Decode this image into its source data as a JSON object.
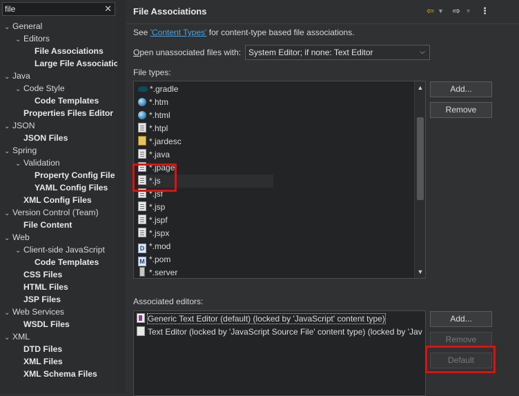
{
  "filter": {
    "value": "file"
  },
  "tree": [
    {
      "label": "General",
      "level": 0,
      "expanded": true,
      "bold": false
    },
    {
      "label": "Editors",
      "level": 1,
      "expanded": true,
      "bold": false
    },
    {
      "label": "File Associations",
      "level": 2,
      "bold": true
    },
    {
      "label": "Large File Associatio",
      "level": 2,
      "bold": true
    },
    {
      "label": "Java",
      "level": 0,
      "expanded": true,
      "bold": false
    },
    {
      "label": "Code Style",
      "level": 1,
      "expanded": true,
      "bold": false
    },
    {
      "label": "Code Templates",
      "level": 2,
      "bold": true
    },
    {
      "label": "Properties Files Editor",
      "level": 1,
      "bold": true
    },
    {
      "label": "JSON",
      "level": 0,
      "expanded": true,
      "bold": false
    },
    {
      "label": "JSON Files",
      "level": 1,
      "bold": true
    },
    {
      "label": "Spring",
      "level": 0,
      "expanded": true,
      "bold": false
    },
    {
      "label": "Validation",
      "level": 1,
      "expanded": true,
      "bold": false
    },
    {
      "label": "Property Config File",
      "level": 2,
      "bold": true
    },
    {
      "label": "YAML Config Files",
      "level": 2,
      "bold": true
    },
    {
      "label": "XML Config Files",
      "level": 1,
      "bold": true
    },
    {
      "label": "Version Control (Team)",
      "level": 0,
      "expanded": true,
      "bold": false
    },
    {
      "label": "File Content",
      "level": 1,
      "bold": true
    },
    {
      "label": "Web",
      "level": 0,
      "expanded": true,
      "bold": false
    },
    {
      "label": "Client-side JavaScript",
      "level": 1,
      "expanded": true,
      "bold": false
    },
    {
      "label": "Code Templates",
      "level": 2,
      "bold": true
    },
    {
      "label": "CSS Files",
      "level": 1,
      "bold": true
    },
    {
      "label": "HTML Files",
      "level": 1,
      "bold": true
    },
    {
      "label": "JSP Files",
      "level": 1,
      "bold": true
    },
    {
      "label": "Web Services",
      "level": 0,
      "expanded": true,
      "bold": false
    },
    {
      "label": "WSDL Files",
      "level": 1,
      "bold": true
    },
    {
      "label": "XML",
      "level": 0,
      "expanded": true,
      "bold": false
    },
    {
      "label": "DTD Files",
      "level": 1,
      "bold": true
    },
    {
      "label": "XML Files",
      "level": 1,
      "bold": true
    },
    {
      "label": "XML Schema Files",
      "level": 1,
      "bold": true
    }
  ],
  "page": {
    "title": "File Associations",
    "see_prefix": "See ",
    "see_link": "'Content Types'",
    "see_suffix": " for content-type based file associations.",
    "open_unassoc_label": "Open unassociated files with:",
    "open_unassoc_value": "System Editor; if none: Text Editor",
    "file_types_label": "File types:",
    "associated_editors_label": "Associated editors:"
  },
  "file_types": [
    {
      "name": "*.gradle",
      "icon": "gradle-icon"
    },
    {
      "name": "*.htm",
      "icon": "globe-icon"
    },
    {
      "name": "*.html",
      "icon": "globe-icon"
    },
    {
      "name": "*.htpl",
      "icon": "file-icon"
    },
    {
      "name": "*.jardesc",
      "icon": "jar-icon"
    },
    {
      "name": "*.java",
      "icon": "file-icon"
    },
    {
      "name": "*.jpage",
      "icon": "file-icon"
    },
    {
      "name": "*.js",
      "icon": "file-icon"
    },
    {
      "name": "*.jsf",
      "icon": "file-icon"
    },
    {
      "name": "*.jsp",
      "icon": "file-icon"
    },
    {
      "name": "*.jspf",
      "icon": "file-icon"
    },
    {
      "name": "*.jspx",
      "icon": "file-icon"
    },
    {
      "name": "*.mod",
      "icon": "d-badge-icon",
      "badge": "D"
    },
    {
      "name": "*.pom",
      "icon": "m-badge-icon",
      "badge": "M"
    },
    {
      "name": "*.server",
      "icon": "server-icon"
    }
  ],
  "editors": [
    {
      "name": "Generic Text Editor (default) (locked by 'JavaScript' content type)",
      "icon": "generic-editor-icon"
    },
    {
      "name": "Text Editor (locked by 'JavaScript Source File' content type) (locked by 'Jav",
      "icon": "text-editor-icon"
    }
  ],
  "buttons": {
    "add_file": "Add...",
    "remove_file": "Remove",
    "add_editor": "Add...",
    "remove_editor": "Remove",
    "default_editor": "Default"
  },
  "header_icons": [
    "back-arrow-icon",
    "forward-arrow-icon",
    "menu-icon"
  ],
  "colors": {
    "highlight": "#e01010",
    "link": "#4aa3df"
  }
}
